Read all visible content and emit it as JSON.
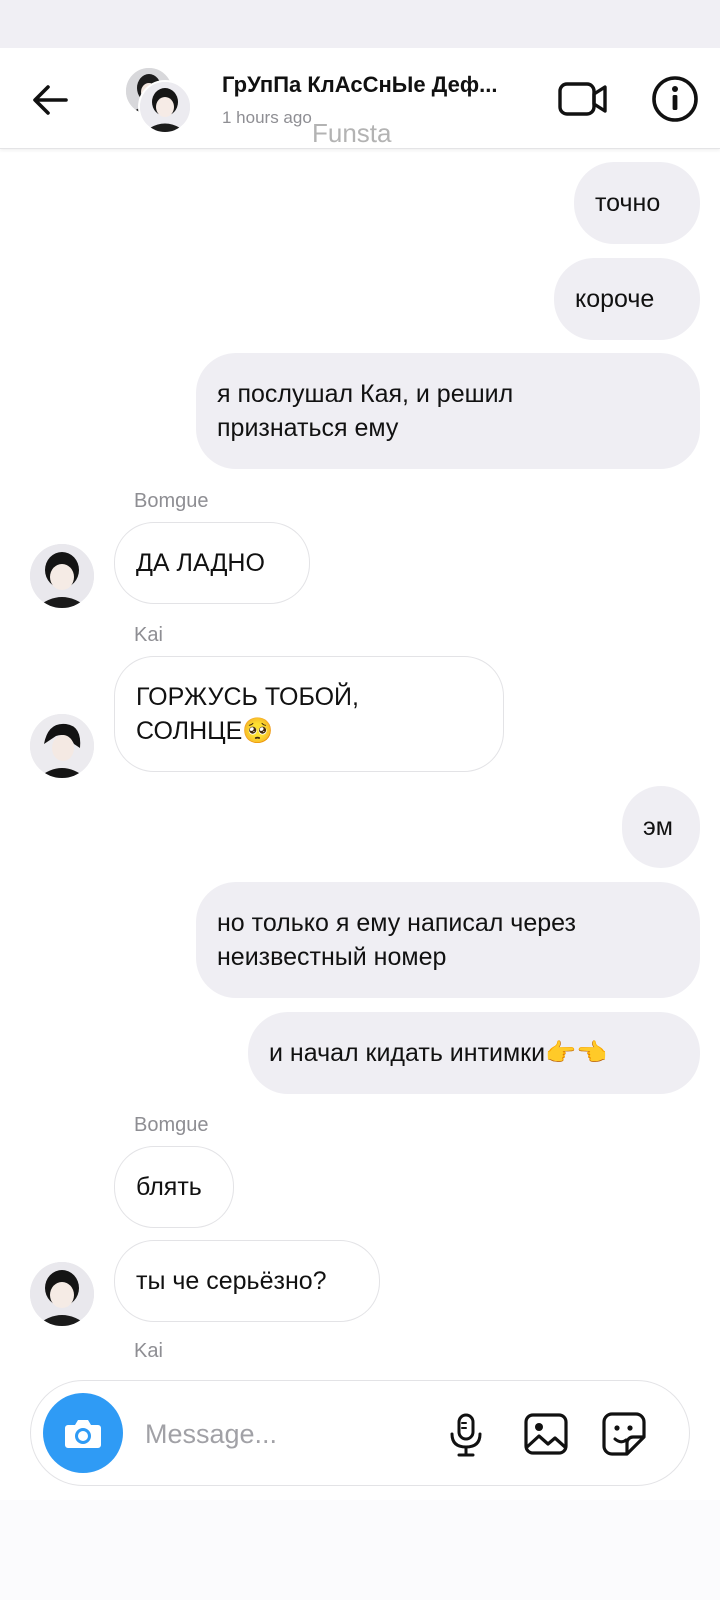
{
  "header": {
    "title": "ГрУпПа КлАсСнЫе Деф...",
    "subtitle": "1 hours ago",
    "watermark": "Funsta"
  },
  "messages": [
    {
      "dir": "out",
      "text": "точно"
    },
    {
      "dir": "out",
      "text": "короче"
    },
    {
      "dir": "out",
      "text": "я послушал Кая, и решил\nпризнаться ему"
    },
    {
      "dir": "in",
      "sender": "Bomgue",
      "text": "ДА ЛАДНО"
    },
    {
      "dir": "in",
      "sender": "Kai",
      "text": "ГОРЖУСЬ ТОБОЙ,\nСОЛНЦЕ🥺"
    },
    {
      "dir": "out",
      "text": "эм"
    },
    {
      "dir": "out",
      "text": "но только я ему написал через\nнеизвестный номер"
    },
    {
      "dir": "out",
      "text": "и начал кидать интимки👉👈"
    },
    {
      "dir": "in",
      "sender": "Bomgue",
      "text": "блять"
    },
    {
      "dir": "in",
      "text": "ты че серьёзно?"
    },
    {
      "sender_only": "Kai"
    }
  ],
  "composer": {
    "placeholder": "Message..."
  },
  "icons": {
    "back": "arrow-left-icon",
    "video": "video-camera-icon",
    "info": "info-icon",
    "camera": "camera-icon",
    "mic": "microphone-icon",
    "gallery": "image-icon",
    "sticker": "sticker-icon"
  },
  "colors": {
    "accent": "#2f9bf5",
    "outgoing_bubble": "#efeef3",
    "muted_text": "#8e8e93"
  }
}
